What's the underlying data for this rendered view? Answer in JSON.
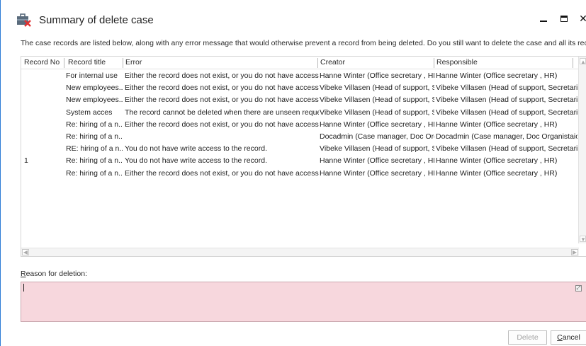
{
  "window": {
    "title": "Summary of delete case",
    "icon": "briefcase-delete-icon"
  },
  "instruction": "The case records are listed below, along with any error message that would otherwise prevent a record from being deleted. Do you still want to delete the case and all its records?",
  "table": {
    "columns": [
      "Record No",
      "Record title",
      "Error",
      "Creator",
      "Responsible"
    ],
    "rows": [
      [
        "",
        "For internal use",
        "Either the record does not exist, or you do not have access to it.",
        "Hanne Winter (Office secretary , HR)",
        "Hanne Winter (Office secretary , HR)"
      ],
      [
        "",
        "New employees...",
        "Either the record does not exist, or you do not have access to it.",
        "Vibeke Villasen (Head of support, S...",
        "Vibeke Villasen (Head of support, Secretaria..."
      ],
      [
        "",
        "New employees...",
        "Either the record does not exist, or you do not have access to it.",
        "Vibeke Villasen (Head of support, S...",
        "Vibeke Villasen (Head of support, Secretaria..."
      ],
      [
        "",
        "System acces",
        "The record cannot be deleted when there are unseen requests.",
        "Vibeke Villasen (Head of support, S...",
        "Vibeke Villasen (Head of support, Secretaria..."
      ],
      [
        "",
        "Re: hiring of a n...",
        "Either the record does not exist, or you do not have access to it.",
        "Hanne Winter (Office secretary , HR)",
        "Hanne Winter (Office secretary , HR)"
      ],
      [
        "",
        "Re: hiring of a n...",
        "",
        "Docadmin (Case manager, Doc Org...",
        "Docadmin (Case manager, Doc Organistaion)"
      ],
      [
        "",
        "RE: hiring of a n...",
        "You do not have write access to the record.",
        "Vibeke Villasen (Head of support, S...",
        "Vibeke Villasen (Head of support, Secretaria..."
      ],
      [
        "1",
        "Re: hiring of a n...",
        "You do not have write access to the record.",
        "Hanne Winter (Office secretary , HR)",
        "Hanne Winter (Office secretary , HR)"
      ],
      [
        "",
        "Re: hiring of a n...",
        "Either the record does not exist, or you do not have access to it.",
        "Hanne Winter (Office secretary , HR)",
        "Hanne Winter (Office secretary , HR)"
      ]
    ]
  },
  "reason": {
    "label_underlined": "R",
    "label_rest": "eason for deletion:",
    "value": ""
  },
  "buttons": {
    "delete": "Delete",
    "cancel_underlined": "C",
    "cancel_rest": "ancel"
  },
  "colors": {
    "reason_background": "#f7d7dd",
    "window_border": "#2b7bd6",
    "disabled_text": "#a3a3a3"
  }
}
